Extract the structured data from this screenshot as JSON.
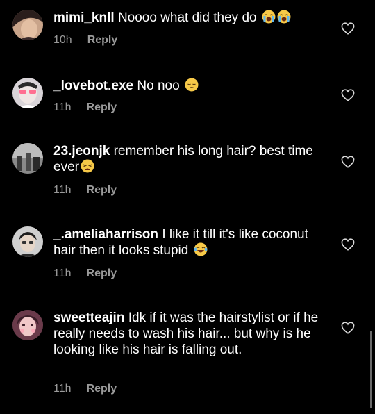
{
  "comments": [
    {
      "username": "mimi_knll",
      "text": "Noooo what did they do",
      "emojis": [
        "loudly-crying-face",
        "loudly-crying-face"
      ],
      "time": "10h",
      "reply_label": "Reply"
    },
    {
      "username": "_lovebot.exe",
      "text": "No noo",
      "emojis": [
        "pensive-face"
      ],
      "time": "11h",
      "reply_label": "Reply"
    },
    {
      "username": "23.jeonjk",
      "text": "remember his long hair? best time ever",
      "emojis": [
        "weary-face"
      ],
      "time": "11h",
      "reply_label": "Reply"
    },
    {
      "username": "_.ameliaharrison",
      "text": "I like it till it's like coconut hair then it looks stupid",
      "emojis": [
        "face-with-tears-of-joy"
      ],
      "time": "11h",
      "reply_label": "Reply"
    },
    {
      "username": "sweetteajin",
      "text": "Idk if it was the hairstylist or if he really needs to wash his hair... but why is he looking like his hair is falling out.",
      "emojis": [],
      "time": "11h",
      "reply_label": "Reply"
    }
  ],
  "icons": {
    "like": "heart-outline-icon"
  },
  "colors": {
    "background": "#000000",
    "text": "#ffffff",
    "secondary": "#9a9a9a"
  }
}
